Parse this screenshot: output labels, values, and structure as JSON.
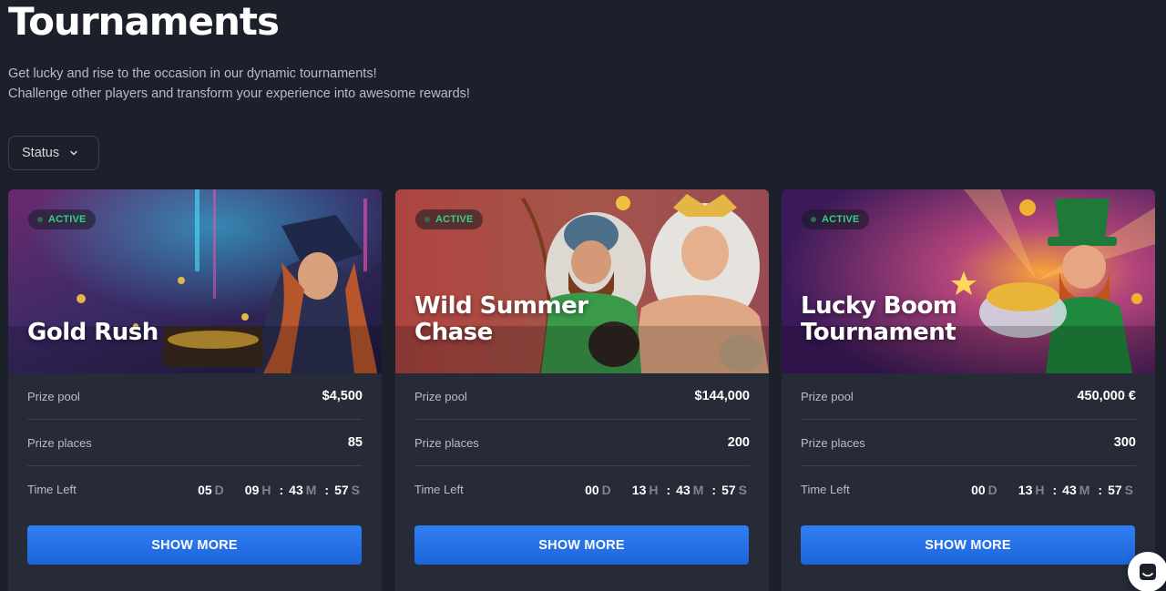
{
  "page": {
    "title": "Tournaments",
    "intro_line1": "Get lucky and rise to the occasion in our dynamic tournaments!",
    "intro_line2": "Challenge other players and transform your experience into awesome rewards!"
  },
  "filter": {
    "label": "Status",
    "icon": "chevron-down-icon"
  },
  "labels": {
    "prize_pool": "Prize pool",
    "prize_places": "Prize places",
    "time_left": "Time Left",
    "show_more": "SHOW MORE",
    "unit_d": "D",
    "unit_h": "H",
    "unit_m": "M",
    "unit_s": "S",
    "sep": ":"
  },
  "colors": {
    "accent": "#2f80f3",
    "status_active": "#34d27b",
    "background": "#1c202a",
    "card": "#262b37"
  },
  "tournaments": [
    {
      "status": "ACTIVE",
      "title": "Gold Rush",
      "prize_pool": "$4,500",
      "prize_places": "85",
      "time_left": {
        "d": "05",
        "h": "09",
        "m": "43",
        "s": "57"
      }
    },
    {
      "status": "ACTIVE",
      "title": "Wild Summer\nChase",
      "prize_pool": "$144,000",
      "prize_places": "200",
      "time_left": {
        "d": "00",
        "h": "13",
        "m": "43",
        "s": "57"
      }
    },
    {
      "status": "ACTIVE",
      "title": "Lucky Boom\nTournament",
      "prize_pool": "450,000 €",
      "prize_places": "300",
      "time_left": {
        "d": "00",
        "h": "13",
        "m": "43",
        "s": "57"
      }
    }
  ],
  "chat": {
    "icon": "chat-icon"
  }
}
